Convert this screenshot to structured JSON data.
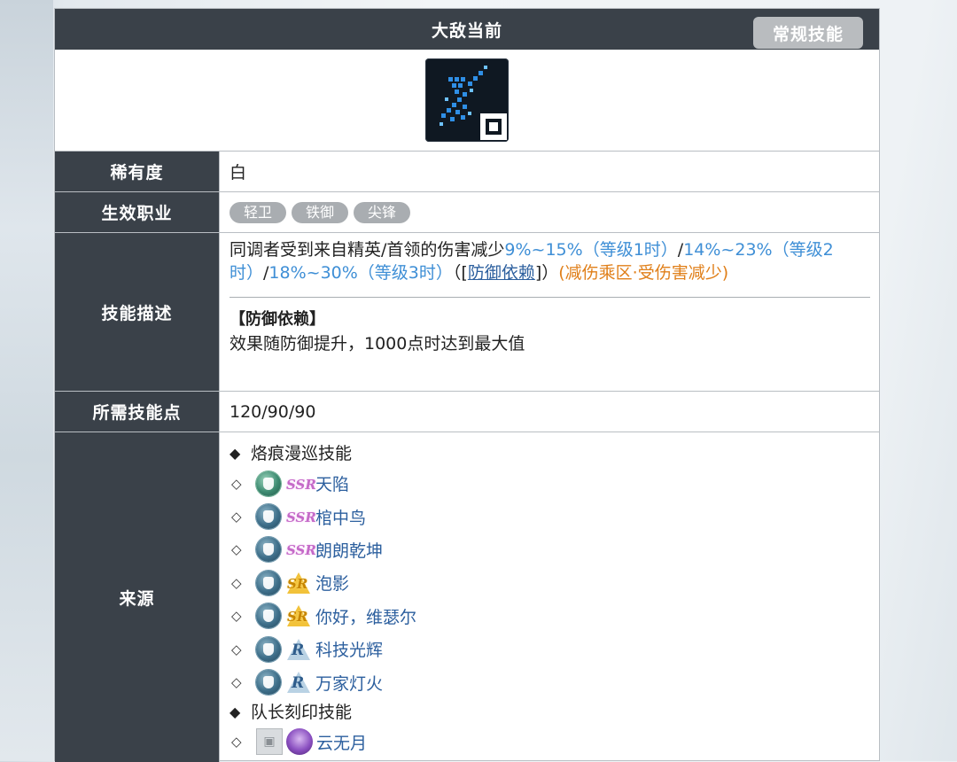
{
  "title": "大敌当前",
  "skill_type_button": "常规技能",
  "skill_icon_name": "skill-emblem-icon",
  "rows": {
    "rarity": {
      "label": "稀有度",
      "value": "白"
    },
    "classes": {
      "label": "生效职业",
      "tags": [
        "轻卫",
        "铁御",
        "尖锋"
      ]
    },
    "description": {
      "label": "技能描述",
      "part1": "同调者受到来自精英/首领的伤害减少",
      "lv1": "9%~15%（等级1时）",
      "sep1": "/",
      "lv2": "14%~23%（等级2时）",
      "sep2": "/",
      "lv3": "18%~30%（等级3时）",
      "open": "（[",
      "link": "防御依赖",
      "close": "]）",
      "tag": "(减伤乘区·受伤害减少)",
      "note_title": "【防御依赖】",
      "note_text": "效果随防御提升，1000点时达到最大值"
    },
    "cost": {
      "label": "所需技能点",
      "value": "120/90/90"
    },
    "source": {
      "label": "来源",
      "cat1": "烙痕漫巡技能",
      "items": [
        {
          "role": "green",
          "rarity": "SSR",
          "name": "天陷"
        },
        {
          "role": "blue",
          "rarity": "SSR",
          "name": "棺中鸟"
        },
        {
          "role": "blue",
          "rarity": "SSR",
          "name": "朗朗乾坤"
        },
        {
          "role": "blue",
          "rarity": "SR",
          "name": "泡影"
        },
        {
          "role": "blue",
          "rarity": "SR",
          "name": "你好，维瑟尔"
        },
        {
          "role": "blue",
          "rarity": "R",
          "name": "科技光辉"
        },
        {
          "role": "blue",
          "rarity": "R",
          "name": "万家灯火"
        }
      ],
      "cat2": "队长刻印技能",
      "captain_item": {
        "name": "云无月"
      }
    }
  },
  "symbols": {
    "filled_bullet": "◆",
    "hollow_bullet": "◇"
  },
  "colors": {
    "header_bg": "#3a4149",
    "link_blue": "#2c5f9e",
    "value_blue": "#3f8fd6",
    "orange": "#e07f19",
    "tag_gray": "#a9adb1"
  }
}
